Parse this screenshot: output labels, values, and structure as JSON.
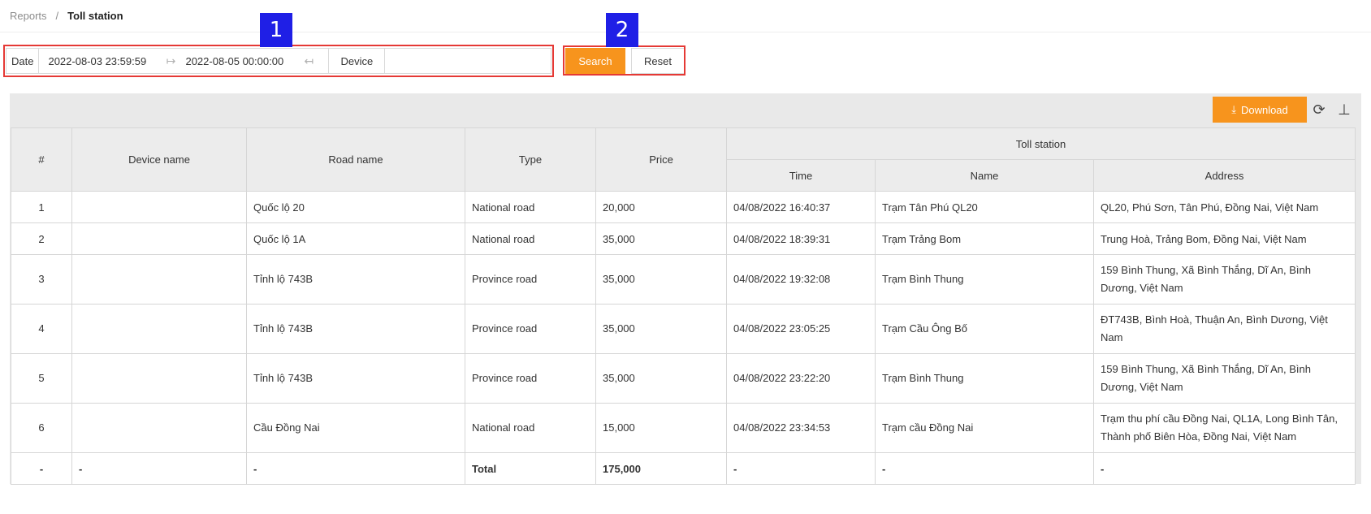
{
  "breadcrumb": {
    "parent": "Reports",
    "separator": "/",
    "current": "Toll station"
  },
  "filter": {
    "date_label": "Date",
    "date_start": "2022-08-03 23:59:59",
    "date_end": "2022-08-05 00:00:00",
    "device_label": "Device",
    "device_value": ""
  },
  "markers": {
    "one": "1",
    "two": "2"
  },
  "buttons": {
    "search": "Search",
    "reset": "Reset",
    "download": "Download"
  },
  "icons": {
    "refresh": "refresh-icon",
    "column_height": "column-height-icon",
    "download": "download-icon"
  },
  "colors": {
    "accent": "#f7941d",
    "highlight": "#e53935",
    "marker": "#1f1fe6"
  },
  "table": {
    "headers": {
      "index": "#",
      "device_name": "Device name",
      "road_name": "Road name",
      "type": "Type",
      "price": "Price",
      "toll_station": "Toll station",
      "time": "Time",
      "name": "Name",
      "address": "Address"
    },
    "rows": [
      {
        "index": "1",
        "device_name": "",
        "road_name": "Quốc lộ 20",
        "type": "National road",
        "price": "20,000",
        "time": "04/08/2022 16:40:37",
        "name": "Trạm Tân Phú QL20",
        "address": "QL20, Phú Sơn, Tân Phú, Đồng Nai, Việt Nam"
      },
      {
        "index": "2",
        "device_name": "",
        "road_name": "Quốc lộ 1A",
        "type": "National road",
        "price": "35,000",
        "time": "04/08/2022 18:39:31",
        "name": "Trạm Trảng Bom",
        "address": "Trung Hoà, Trảng Bom, Đồng Nai, Việt Nam"
      },
      {
        "index": "3",
        "device_name": "",
        "road_name": "Tỉnh lộ 743B",
        "type": "Province road",
        "price": "35,000",
        "time": "04/08/2022 19:32:08",
        "name": "Trạm Bình Thung",
        "address": "159 Bình Thung, Xã Bình Thắng, Dĩ An, Bình Dương, Việt Nam"
      },
      {
        "index": "4",
        "device_name": "",
        "road_name": "Tỉnh lộ 743B",
        "type": "Province road",
        "price": "35,000",
        "time": "04/08/2022 23:05:25",
        "name": "Trạm Cầu Ông Bố",
        "address": "ĐT743B, Bình Hoà, Thuận An, Bình Dương, Việt Nam"
      },
      {
        "index": "5",
        "device_name": "",
        "road_name": "Tỉnh lộ 743B",
        "type": "Province road",
        "price": "35,000",
        "time": "04/08/2022 23:22:20",
        "name": "Trạm Bình Thung",
        "address": "159 Bình Thung, Xã Bình Thắng, Dĩ An, Bình Dương, Việt Nam"
      },
      {
        "index": "6",
        "device_name": "",
        "road_name": "Cầu Đồng Nai",
        "type": "National road",
        "price": "15,000",
        "time": "04/08/2022 23:34:53",
        "name": "Trạm cầu Đồng Nai",
        "address": "Trạm thu phí cầu Đồng Nai, QL1A, Long Bình Tân, Thành phố Biên Hòa, Đồng Nai, Việt Nam"
      }
    ],
    "total": {
      "index": "-",
      "device_name": "-",
      "road_name": "-",
      "type": "Total",
      "price": "175,000",
      "time": "-",
      "name": "-",
      "address": "-"
    }
  }
}
